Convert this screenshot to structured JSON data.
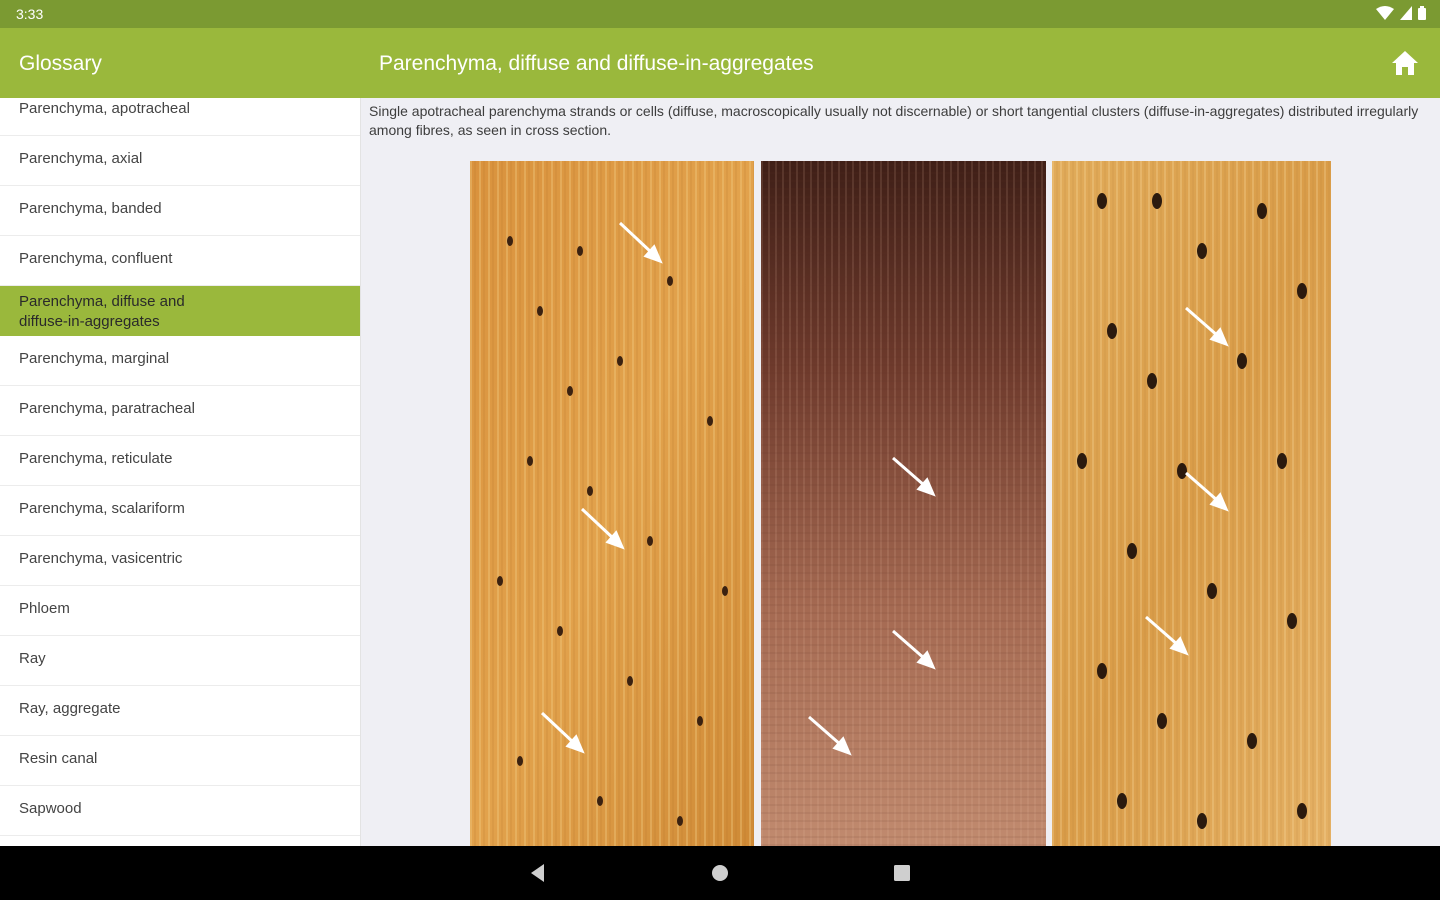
{
  "status_bar": {
    "time": "3:33"
  },
  "app_bar": {
    "title": "Glossary",
    "detail_title": "Parenchyma, diffuse and diffuse-in-aggregates"
  },
  "sidebar": {
    "items": [
      {
        "label": "Parenchyma, apotracheal"
      },
      {
        "label": "Parenchyma, axial"
      },
      {
        "label": "Parenchyma, banded"
      },
      {
        "label": "Parenchyma, confluent"
      },
      {
        "label": "Parenchyma, diffuse and diffuse-in-aggregates",
        "selected": true
      },
      {
        "label": "Parenchyma, marginal"
      },
      {
        "label": "Parenchyma, paratracheal"
      },
      {
        "label": "Parenchyma, reticulate"
      },
      {
        "label": "Parenchyma, scalariform"
      },
      {
        "label": "Parenchyma, vasicentric"
      },
      {
        "label": "Phloem"
      },
      {
        "label": "Ray"
      },
      {
        "label": "Ray, aggregate"
      },
      {
        "label": "Resin canal"
      },
      {
        "label": "Sapwood"
      }
    ]
  },
  "content": {
    "description": "Single apotracheal parenchyma strands or cells (diffuse, macroscopically usually not discernable) or short tangential clusters (diffuse-in-aggregates) distributed irregularly among fibres, as seen in cross section."
  },
  "colors": {
    "status_bar": "#7b9a32",
    "app_bar": "#9ab83c",
    "selected": "#9ab83c",
    "content_bg": "#efeff4"
  },
  "icons": {
    "home": "home-icon",
    "back": "back-icon",
    "home_nav": "home-nav-icon",
    "recents": "recents-icon",
    "wifi": "wifi-icon",
    "signal": "signal-icon",
    "battery": "battery-icon"
  }
}
